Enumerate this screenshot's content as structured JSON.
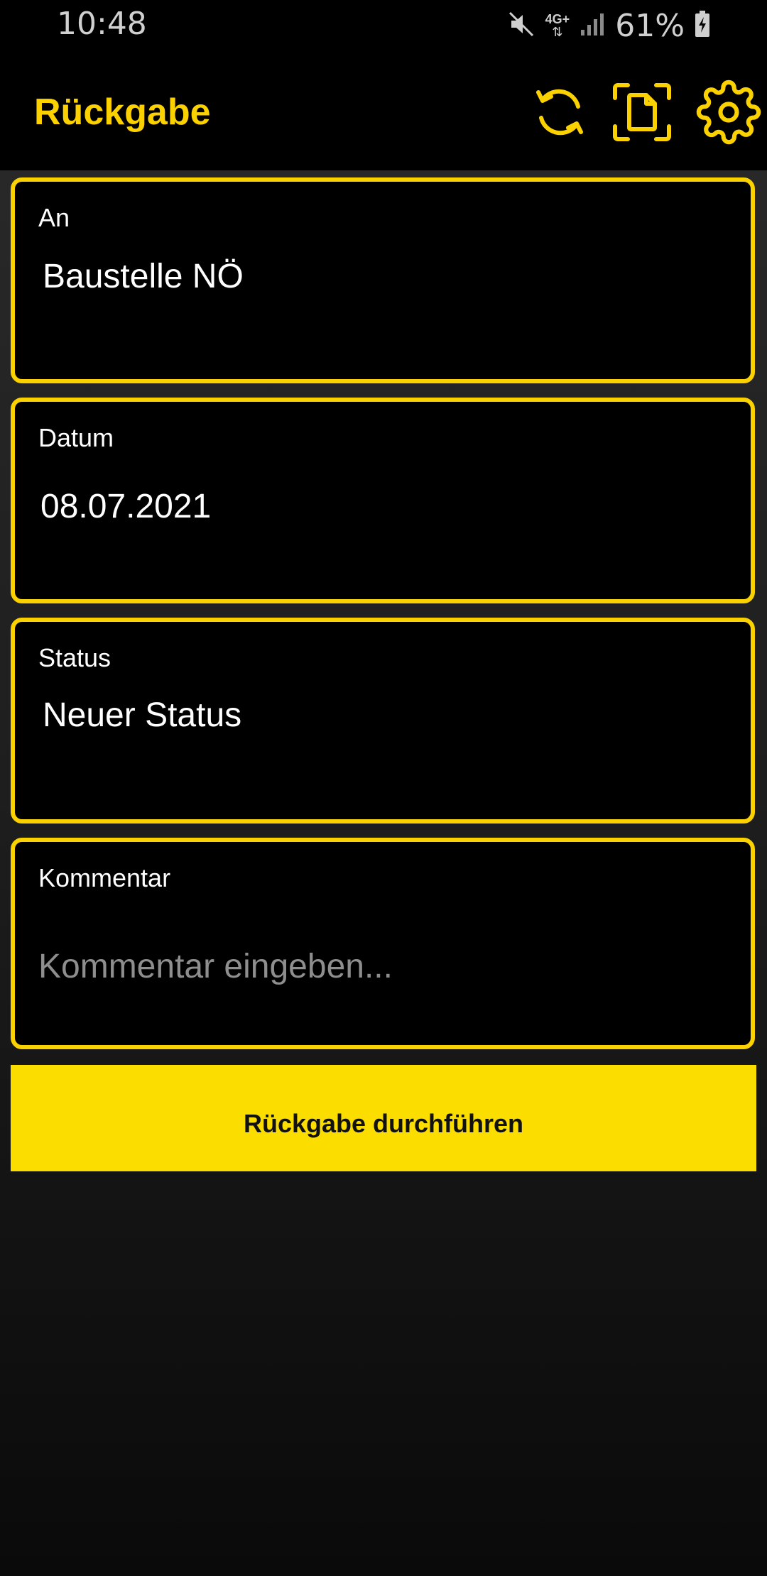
{
  "status_bar": {
    "time": "10:48",
    "network": "4G+",
    "battery": "61%"
  },
  "app_bar": {
    "title": "Rückgabe",
    "icons": [
      "sync-icon",
      "scan-document-icon",
      "settings-gear-icon"
    ]
  },
  "form": {
    "an": {
      "label": "An",
      "value": "Baustelle NÖ"
    },
    "datum": {
      "label": "Datum",
      "value": "08.07.2021"
    },
    "status": {
      "label": "Status",
      "value": "Neuer Status"
    },
    "kommentar": {
      "label": "Kommentar",
      "value": "",
      "placeholder": "Kommentar eingeben..."
    }
  },
  "submit_label": "Rückgabe durchführen",
  "colors": {
    "accent": "#fbd200",
    "button": "#fbde00",
    "background": "#000000"
  }
}
